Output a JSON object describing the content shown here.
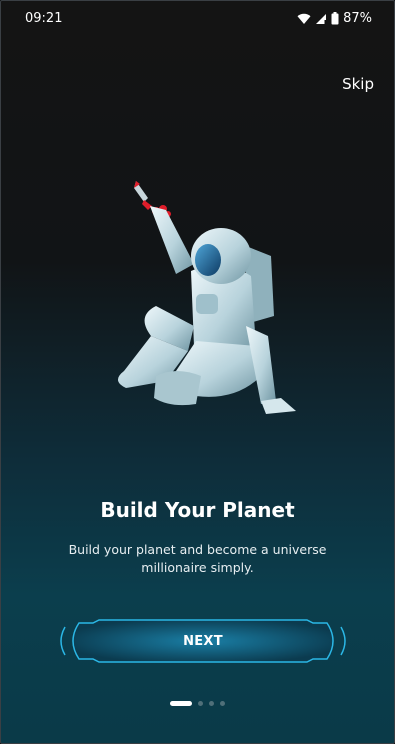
{
  "status_bar": {
    "time": "09:21",
    "battery": "87%"
  },
  "onboarding": {
    "skip_label": "Skip",
    "title": "Build Your Planet",
    "subtitle": "Build your planet and become a universe millionaire simply.",
    "next_label": "NEXT",
    "page_total": 4,
    "page_current": 1
  },
  "colors": {
    "accent": "#2bb7e6",
    "rocket": "#e01d2a",
    "background_top": "#141414",
    "background_bottom": "#0a3a48"
  },
  "icons": {
    "wifi": "wifi-icon",
    "signal": "cell-signal-icon",
    "battery": "battery-icon"
  }
}
